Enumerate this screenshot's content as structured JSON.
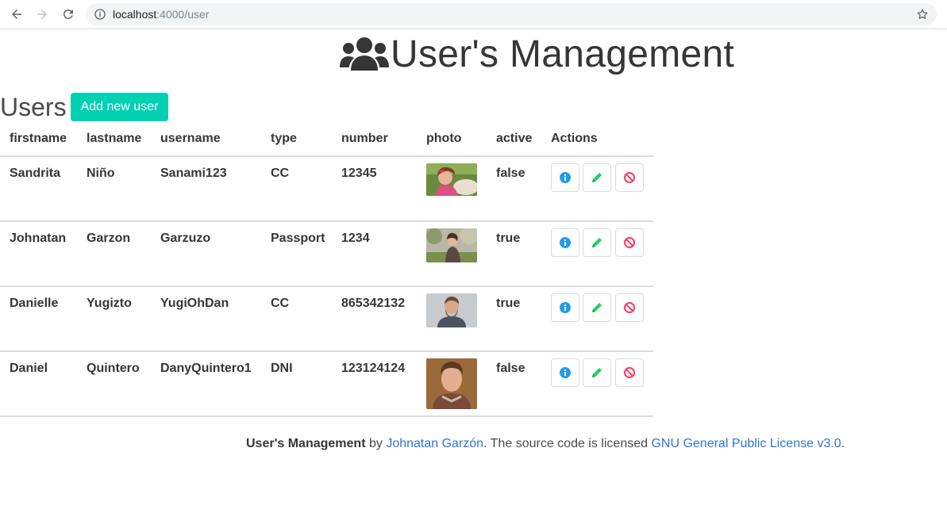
{
  "browser": {
    "url_host": "localhost",
    "url_path": ":4000/user",
    "icons": [
      "back-icon",
      "forward-icon",
      "reload-icon",
      "info-icon",
      "star-icon"
    ]
  },
  "header": {
    "title": "User's Management",
    "icon": "users-icon"
  },
  "section": {
    "title": "Users",
    "add_button": "Add new user"
  },
  "table": {
    "columns": [
      "firstname",
      "lastname",
      "username",
      "type",
      "number",
      "photo",
      "active",
      "Actions"
    ],
    "rows": [
      {
        "firstname": "Sandrita",
        "lastname": "Niño",
        "username": "Sanami123",
        "type": "CC",
        "number": "12345",
        "active": "false"
      },
      {
        "firstname": "Johnatan",
        "lastname": "Garzon",
        "username": "Garzuzo",
        "type": "Passport",
        "number": "1234",
        "active": "true"
      },
      {
        "firstname": "Danielle",
        "lastname": "Yugizto",
        "username": "YugiOhDan",
        "type": "CC",
        "number": "865342132",
        "active": "true"
      },
      {
        "firstname": "Daniel",
        "lastname": "Quintero",
        "username": "DanyQuintero1",
        "type": "DNI",
        "number": "123124124",
        "active": "false"
      }
    ],
    "action_icons": [
      "info-icon",
      "pencil-icon",
      "ban-icon"
    ],
    "action_colors": {
      "info": "#209cee",
      "edit": "#23d160",
      "delete": "#ff3860"
    }
  },
  "footer": {
    "brand": "User's Management",
    "by": " by ",
    "author": "Johnatan Garzón",
    "text": ". The source code is licensed ",
    "license": "GNU General Public License v3.0",
    "end": "."
  },
  "colors": {
    "primary": "#00d1b2",
    "link": "#3273dc",
    "text": "#363636"
  }
}
